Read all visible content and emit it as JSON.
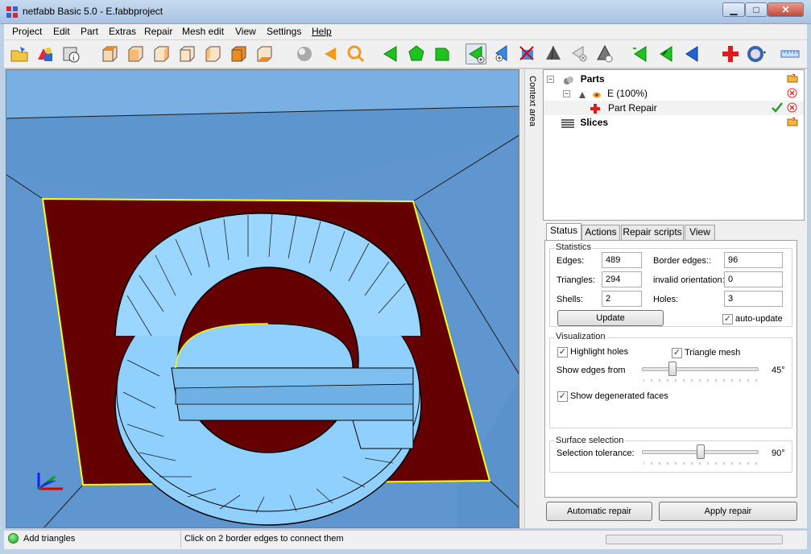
{
  "window": {
    "title": "netfabb Basic 5.0 - E.fabbproject",
    "minimize": "▁",
    "maximize": "□",
    "close": "✕"
  },
  "menu": [
    "Project",
    "Edit",
    "Part",
    "Extras",
    "Repair",
    "Mesh edit",
    "View",
    "Settings",
    "Help"
  ],
  "toolbar_icons": [
    "open-project-icon",
    "add-part-icon",
    "part-info-icon",
    "view-top-icon",
    "view-front-icon",
    "view-side-icon",
    "view-back-icon",
    "view-left-icon",
    "view-right-icon",
    "view-bottom-icon",
    "shaded-sphere-icon",
    "rotate-icon",
    "zoom-icon",
    "select-triangle-icon",
    "select-shell-icon",
    "select-surface-icon",
    "add-triangle-icon",
    "add-point-icon",
    "cut-triangle-icon",
    "tetrahedron-icon",
    "remove-triangle-icon",
    "remove-shell-icon",
    "flip-triangle-icon",
    "flip-surface-icon",
    "flip-shell-icon",
    "repair-cross-icon",
    "render-mode-icon",
    "ruler-icon"
  ],
  "context_area": "Context area",
  "tree": {
    "parts": "Parts",
    "part": "E (100%)",
    "repair": "Part Repair",
    "slices": "Slices"
  },
  "tabs": [
    "Status",
    "Actions",
    "Repair scripts",
    "View"
  ],
  "statistics": {
    "title": "Statistics",
    "edges_label": "Edges:",
    "edges": "489",
    "triangles_label": "Triangles:",
    "triangles": "294",
    "shells_label": "Shells:",
    "shells": "2",
    "border_label": "Border edges::",
    "border": "96",
    "invalid_label": "invalid orientation:",
    "invalid": "0",
    "holes_label": "Holes:",
    "holes": "3",
    "update": "Update",
    "auto_update": "auto-update"
  },
  "visualization": {
    "title": "Visualization",
    "highlight_holes": "Highlight holes",
    "triangle_mesh": "Triangle mesh",
    "show_edges_label": "Show edges from",
    "show_edges_value": "45°",
    "show_edges_fraction": 0.26,
    "degenerated": "Show degenerated faces"
  },
  "surface": {
    "title": "Surface selection",
    "tolerance_label": "Selection tolerance:",
    "tolerance_value": "90°",
    "tolerance_fraction": 0.5
  },
  "buttons": {
    "auto_repair": "Automatic repair",
    "apply_repair": "Apply repair"
  },
  "status": {
    "tool": "Add triangles",
    "hint": "Click on 2 border edges to connect them"
  },
  "colors": {
    "viewport_bg": "#5f96cf",
    "part_fill": "#640000",
    "border_edge": "#ffff00",
    "mesh_fill": "#8fd0ff"
  }
}
